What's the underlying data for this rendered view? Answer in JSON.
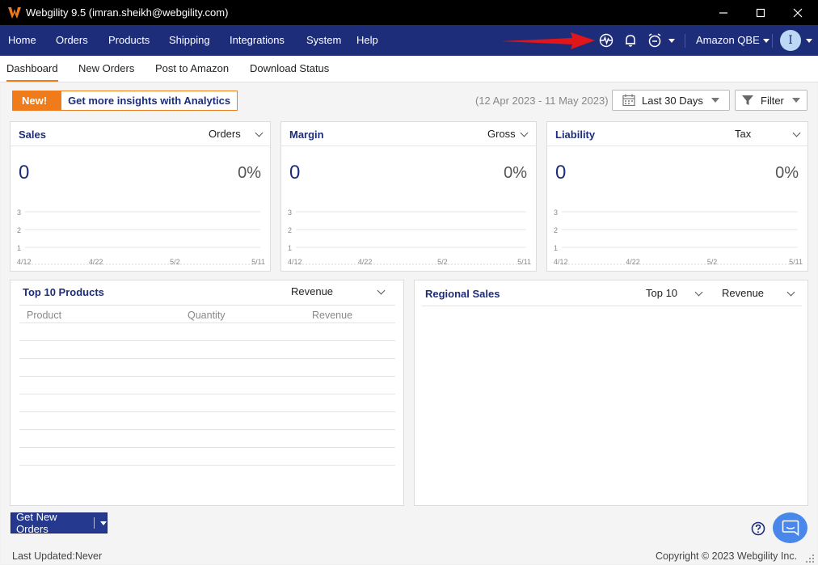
{
  "window": {
    "title": "Webgility 9.5 (imran.sheikh@webgility.com)",
    "controls": [
      "minimize-icon",
      "maximize-icon",
      "close-icon"
    ]
  },
  "nav": {
    "items": [
      "Home",
      "Orders",
      "Products",
      "Shipping",
      "Integrations",
      "System",
      "Help"
    ],
    "icons": [
      "activity-pulse-icon",
      "bell-icon",
      "alarm-clock-icon"
    ],
    "account": "Amazon QBE",
    "user_initial": "I"
  },
  "tabs": {
    "items": [
      "Dashboard",
      "New Orders",
      "Post to Amazon",
      "Download Status"
    ],
    "active": "Dashboard"
  },
  "promo": {
    "badge": "New!",
    "message": "Get more insights with Analytics"
  },
  "toolbar": {
    "date_range": "(12 Apr 2023 - 11 May 2023)",
    "period": "Last 30 Days",
    "filter": "Filter"
  },
  "cards": {
    "sales": {
      "title": "Sales",
      "selector": "Orders",
      "value": "0",
      "percent": "0%"
    },
    "margin": {
      "title": "Margin",
      "selector": "Gross",
      "value": "0",
      "percent": "0%"
    },
    "liability": {
      "title": "Liability",
      "selector": "Tax",
      "value": "0",
      "percent": "0%"
    }
  },
  "chart_data": [
    {
      "type": "line",
      "x": [
        "4/12",
        "4/22",
        "5/2",
        "5/11"
      ],
      "y_ticks": [
        "3",
        "2",
        "1"
      ],
      "series": []
    },
    {
      "type": "line",
      "x": [
        "4/12",
        "4/22",
        "5/2",
        "5/11"
      ],
      "y_ticks": [
        "3",
        "2",
        "1"
      ],
      "series": []
    },
    {
      "type": "line",
      "x": [
        "4/12",
        "4/22",
        "5/2",
        "5/11"
      ],
      "y_ticks": [
        "3",
        "2",
        "1"
      ],
      "series": []
    }
  ],
  "top_products": {
    "title": "Top 10 Products",
    "selector": "Revenue",
    "columns": [
      "Product",
      "Quantity",
      "Revenue"
    ],
    "rows": []
  },
  "regional_sales": {
    "title": "Regional Sales",
    "count_selector": "Top 10",
    "metric_selector": "Revenue"
  },
  "actions": {
    "get_new_orders": "Get New Orders"
  },
  "status": {
    "last_updated": "Last Updated:Never",
    "copyright": "Copyright © 2023 Webgility Inc."
  },
  "colors": {
    "nav_bg": "#1e2d7a",
    "accent": "#f07b1a",
    "primary_button": "#253a8e",
    "chat_button": "#4a87ea"
  }
}
